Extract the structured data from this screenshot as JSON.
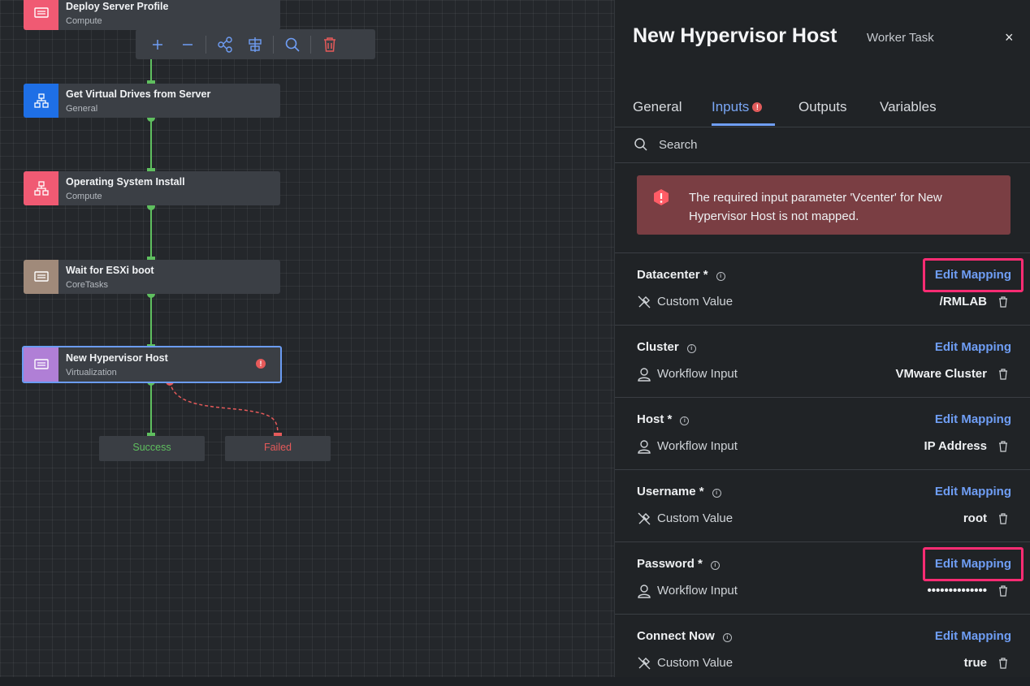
{
  "toolbar": {
    "zoom_in": "zoom-in",
    "zoom_out": "zoom-out",
    "auto_layout": "auto-layout",
    "align": "align",
    "search": "search",
    "delete": "delete"
  },
  "workflow": {
    "nodes": [
      {
        "title": "Deploy Server Profile",
        "subtitle": "Compute",
        "color": "#f05a73",
        "icon": "workertask-icon"
      },
      {
        "title": "Get Virtual Drives from Server",
        "subtitle": "General",
        "color": "#1e6fe6",
        "icon": "workflow-icon"
      },
      {
        "title": "Operating System Install",
        "subtitle": "Compute",
        "color": "#f05a73",
        "icon": "workflow-icon"
      },
      {
        "title": "Wait for ESXi boot",
        "subtitle": "CoreTasks",
        "color": "#a08a7a",
        "icon": "workertask-icon"
      },
      {
        "title": "New Hypervisor Host",
        "subtitle": "Virtualization",
        "color": "#b07fd6",
        "icon": "workertask-icon"
      }
    ],
    "success_label": "Success",
    "failed_label": "Failed",
    "error_glyph": "!"
  },
  "panel": {
    "title": "New Hypervisor Host",
    "subtitle": "Worker Task",
    "close": "×",
    "tabs": [
      "General",
      "Inputs",
      "Outputs",
      "Variables"
    ],
    "active_tab": "Inputs",
    "search_placeholder": "Search",
    "alert": "The required input parameter 'Vcenter' for New Hypervisor Host is not mapped.",
    "edit_label": "Edit Mapping",
    "inputs": [
      {
        "label": "Datacenter *",
        "source": "Custom Value",
        "value": "/RMLAB",
        "highlighted": true
      },
      {
        "label": "Cluster",
        "source": "Workflow Input",
        "value": "VMware Cluster",
        "highlighted": false
      },
      {
        "label": "Host *",
        "source": "Workflow Input",
        "value": "IP Address",
        "highlighted": false
      },
      {
        "label": "Username *",
        "source": "Custom Value",
        "value": "root",
        "highlighted": false
      },
      {
        "label": "Password *",
        "source": "Workflow Input",
        "value": "••••••••••••••",
        "highlighted": true
      },
      {
        "label": "Connect Now",
        "source": "Custom Value",
        "value": "true",
        "highlighted": false
      }
    ]
  },
  "colors": {
    "accent": "#6f9ef5",
    "success": "#5fbf5f",
    "error": "#e65a5a",
    "highlight": "#ff2c73"
  }
}
